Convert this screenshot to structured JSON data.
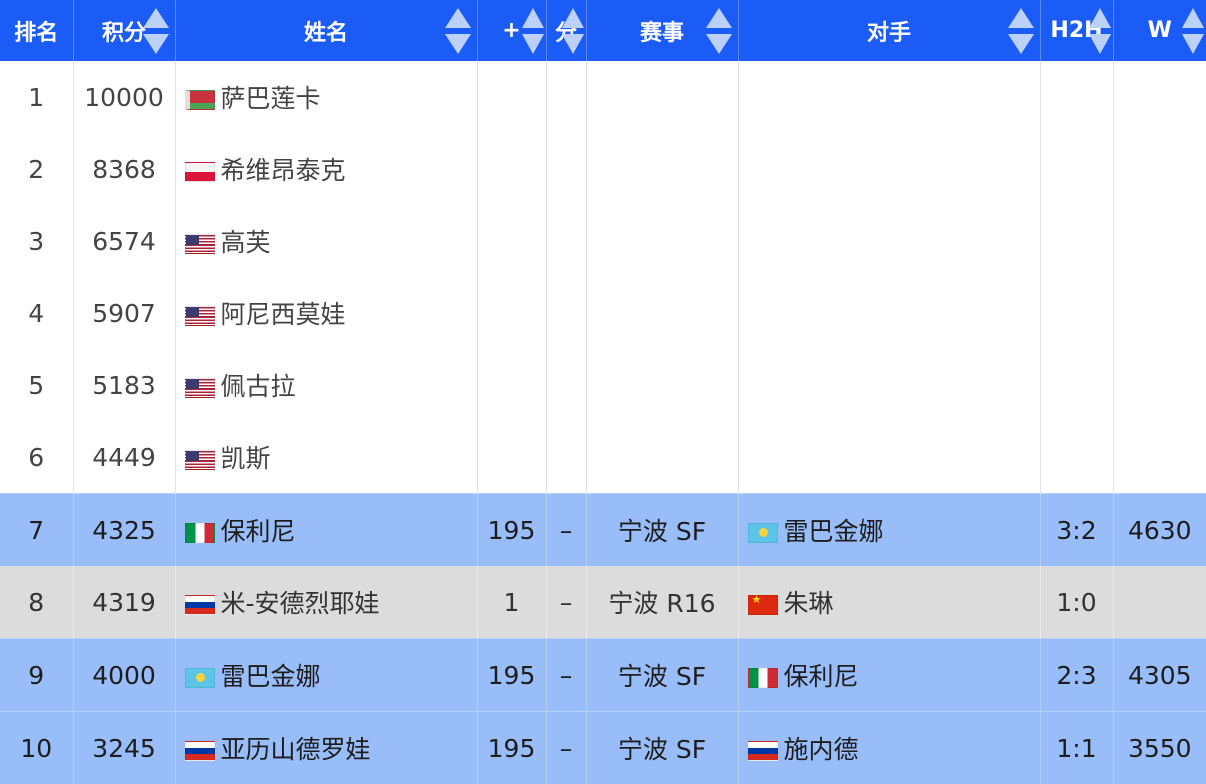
{
  "columns": [
    {
      "label": "排名",
      "sortable": false
    },
    {
      "label": "积分",
      "sortable": true
    },
    {
      "label": "姓名",
      "sortable": true
    },
    {
      "label": "+",
      "sortable": true
    },
    {
      "label": "分",
      "sortable": true
    },
    {
      "label": "赛事",
      "sortable": true
    },
    {
      "label": "对手",
      "sortable": true
    },
    {
      "label": "H2H",
      "sortable": true
    },
    {
      "label": "W",
      "sortable": true
    }
  ],
  "rows": [
    {
      "rank": "1",
      "points": "10000",
      "flag": "belarus-flag-icon",
      "name": "萨巴莲卡",
      "plus": "",
      "pts": "",
      "event": "",
      "opp_flag": "",
      "opponent": "",
      "h2h": "",
      "w": "",
      "style": "plain"
    },
    {
      "rank": "2",
      "points": "8368",
      "flag": "poland-flag-icon",
      "name": "希维昂泰克",
      "plus": "",
      "pts": "",
      "event": "",
      "opp_flag": "",
      "opponent": "",
      "h2h": "",
      "w": "",
      "style": "plain"
    },
    {
      "rank": "3",
      "points": "6574",
      "flag": "usa-flag-icon",
      "name": "高芙",
      "plus": "",
      "pts": "",
      "event": "",
      "opp_flag": "",
      "opponent": "",
      "h2h": "",
      "w": "",
      "style": "plain"
    },
    {
      "rank": "4",
      "points": "5907",
      "flag": "usa-flag-icon",
      "name": "阿尼西莫娃",
      "plus": "",
      "pts": "",
      "event": "",
      "opp_flag": "",
      "opponent": "",
      "h2h": "",
      "w": "",
      "style": "plain"
    },
    {
      "rank": "5",
      "points": "5183",
      "flag": "usa-flag-icon",
      "name": "佩古拉",
      "plus": "",
      "pts": "",
      "event": "",
      "opp_flag": "",
      "opponent": "",
      "h2h": "",
      "w": "",
      "style": "plain"
    },
    {
      "rank": "6",
      "points": "4449",
      "flag": "usa-flag-icon",
      "name": "凯斯",
      "plus": "",
      "pts": "",
      "event": "",
      "opp_flag": "",
      "opponent": "",
      "h2h": "",
      "w": "",
      "style": "plain"
    },
    {
      "rank": "7",
      "points": "4325",
      "flag": "italy-flag-icon",
      "name": "保利尼",
      "plus": "195",
      "pts": "–",
      "event": "宁波 SF",
      "opp_flag": "kazakhstan-flag-icon",
      "opponent": "雷巴金娜",
      "h2h": "3:2",
      "w": "4630",
      "style": "blue"
    },
    {
      "rank": "8",
      "points": "4319",
      "flag": "russia-flag-icon",
      "name": "米-安德烈耶娃",
      "plus": "1",
      "pts": "–",
      "event": "宁波 R16",
      "opp_flag": "china-flag-icon",
      "opponent": "朱琳",
      "h2h": "1:0",
      "w": "",
      "style": "grey"
    },
    {
      "rank": "9",
      "points": "4000",
      "flag": "kazakhstan-flag-icon",
      "name": "雷巴金娜",
      "plus": "195",
      "pts": "–",
      "event": "宁波 SF",
      "opp_flag": "italy-flag-icon",
      "opponent": "保利尼",
      "h2h": "2:3",
      "w": "4305",
      "style": "blue"
    },
    {
      "rank": "10",
      "points": "3245",
      "flag": "russia-flag-icon",
      "name": "亚历山德罗娃",
      "plus": "195",
      "pts": "–",
      "event": "宁波 SF",
      "opp_flag": "russia-flag-icon",
      "opponent": "施内德",
      "h2h": "1:1",
      "w": "3550",
      "style": "blue"
    }
  ],
  "colors": {
    "header_bg": "#1a5cf5",
    "highlight_blue": "#98bdf9",
    "highlight_grey": "#dcdcdc"
  }
}
